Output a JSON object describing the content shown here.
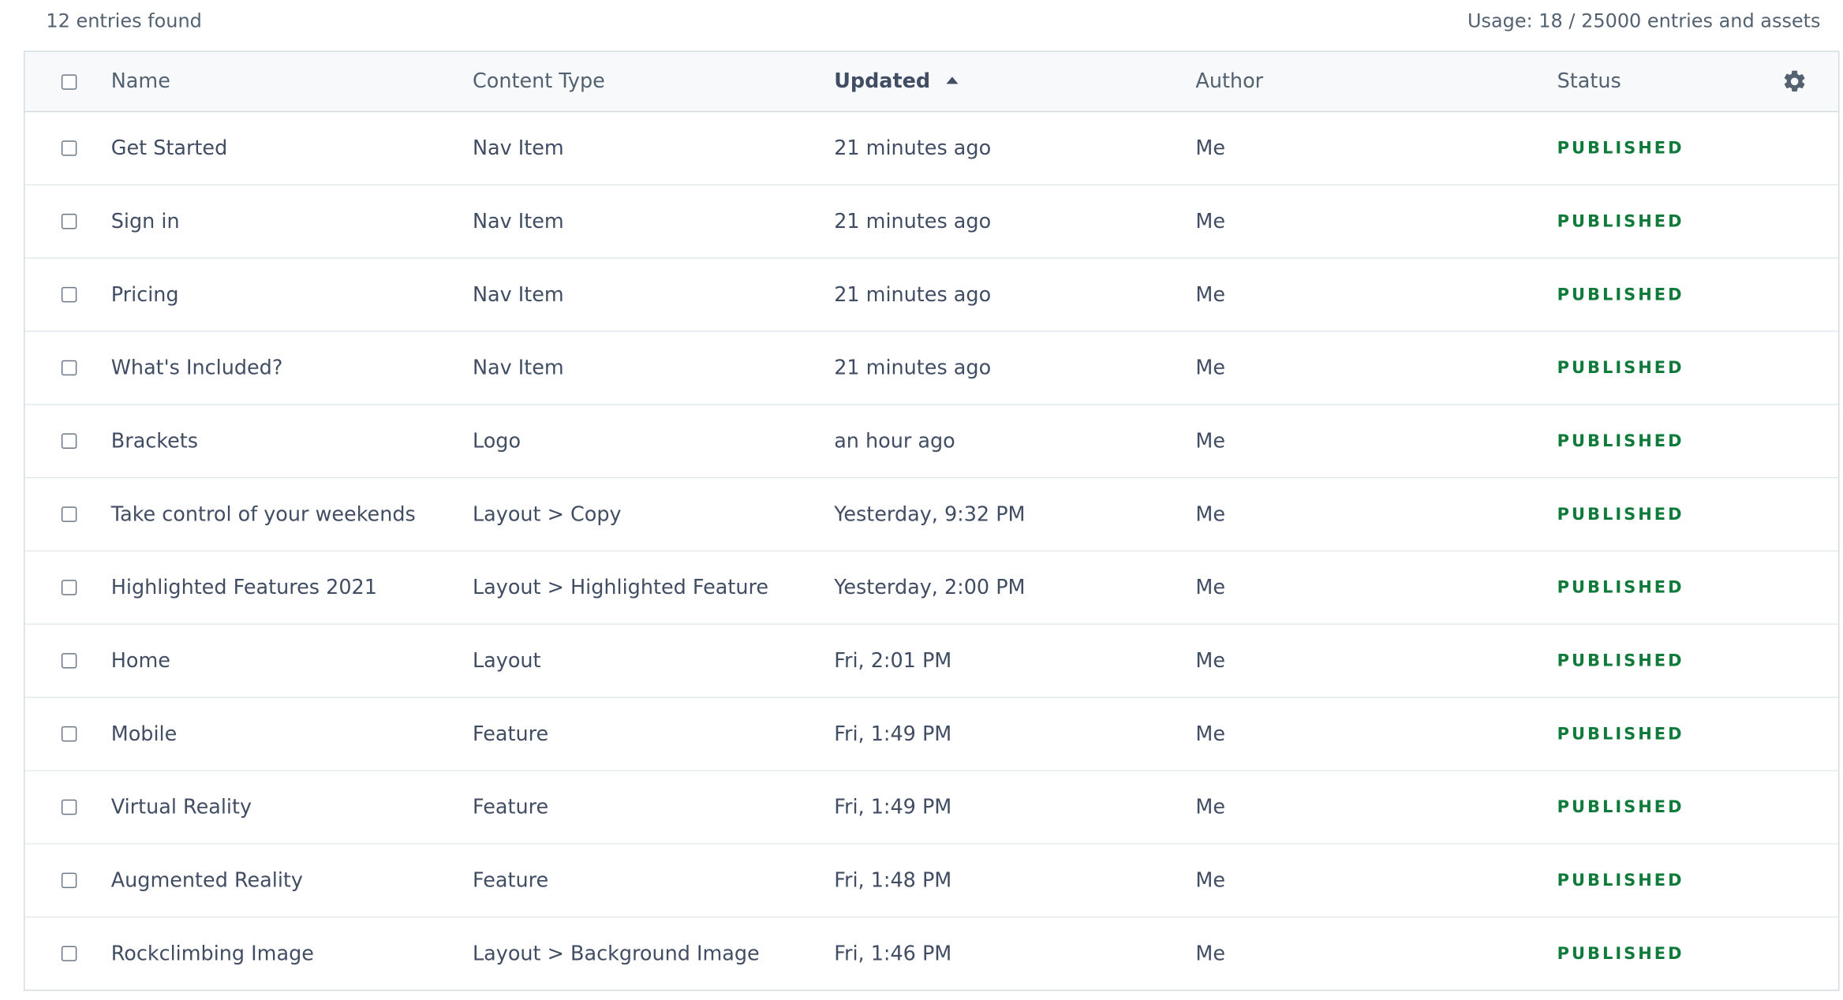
{
  "summary": {
    "entries_found": "12 entries found",
    "usage": "Usage: 18 / 25000 entries and assets"
  },
  "table": {
    "headers": {
      "name": "Name",
      "content_type": "Content Type",
      "updated": "Updated",
      "author": "Author",
      "status": "Status"
    },
    "sort": {
      "column": "Updated",
      "direction": "ascending"
    },
    "settings_icon": "gear-icon",
    "rows": [
      {
        "name": "Get Started",
        "content_type": "Nav Item",
        "updated": "21 minutes ago",
        "author": "Me",
        "status": "PUBLISHED"
      },
      {
        "name": "Sign in",
        "content_type": "Nav Item",
        "updated": "21 minutes ago",
        "author": "Me",
        "status": "PUBLISHED"
      },
      {
        "name": "Pricing",
        "content_type": "Nav Item",
        "updated": "21 minutes ago",
        "author": "Me",
        "status": "PUBLISHED"
      },
      {
        "name": "What's Included?",
        "content_type": "Nav Item",
        "updated": "21 minutes ago",
        "author": "Me",
        "status": "PUBLISHED"
      },
      {
        "name": "Brackets",
        "content_type": "Logo",
        "updated": "an hour ago",
        "author": "Me",
        "status": "PUBLISHED"
      },
      {
        "name": "Take control of your weekends",
        "content_type": "Layout > Copy",
        "updated": "Yesterday, 9:32 PM",
        "author": "Me",
        "status": "PUBLISHED"
      },
      {
        "name": "Highlighted Features 2021",
        "content_type": "Layout > Highlighted Feature",
        "updated": "Yesterday, 2:00 PM",
        "author": "Me",
        "status": "PUBLISHED"
      },
      {
        "name": "Home",
        "content_type": "Layout",
        "updated": "Fri, 2:01 PM",
        "author": "Me",
        "status": "PUBLISHED"
      },
      {
        "name": "Mobile",
        "content_type": "Feature",
        "updated": "Fri, 1:49 PM",
        "author": "Me",
        "status": "PUBLISHED"
      },
      {
        "name": "Virtual Reality",
        "content_type": "Feature",
        "updated": "Fri, 1:49 PM",
        "author": "Me",
        "status": "PUBLISHED"
      },
      {
        "name": "Augmented Reality",
        "content_type": "Feature",
        "updated": "Fri, 1:48 PM",
        "author": "Me",
        "status": "PUBLISHED"
      },
      {
        "name": "Rockclimbing Image",
        "content_type": "Layout > Background Image",
        "updated": "Fri, 1:46 PM",
        "author": "Me",
        "status": "PUBLISHED"
      }
    ]
  },
  "colors": {
    "text": "#414d63",
    "muted_text": "#536171",
    "published": "#0f7a3a",
    "border": "#d3dce0",
    "header_bg": "#f7f9fa"
  }
}
